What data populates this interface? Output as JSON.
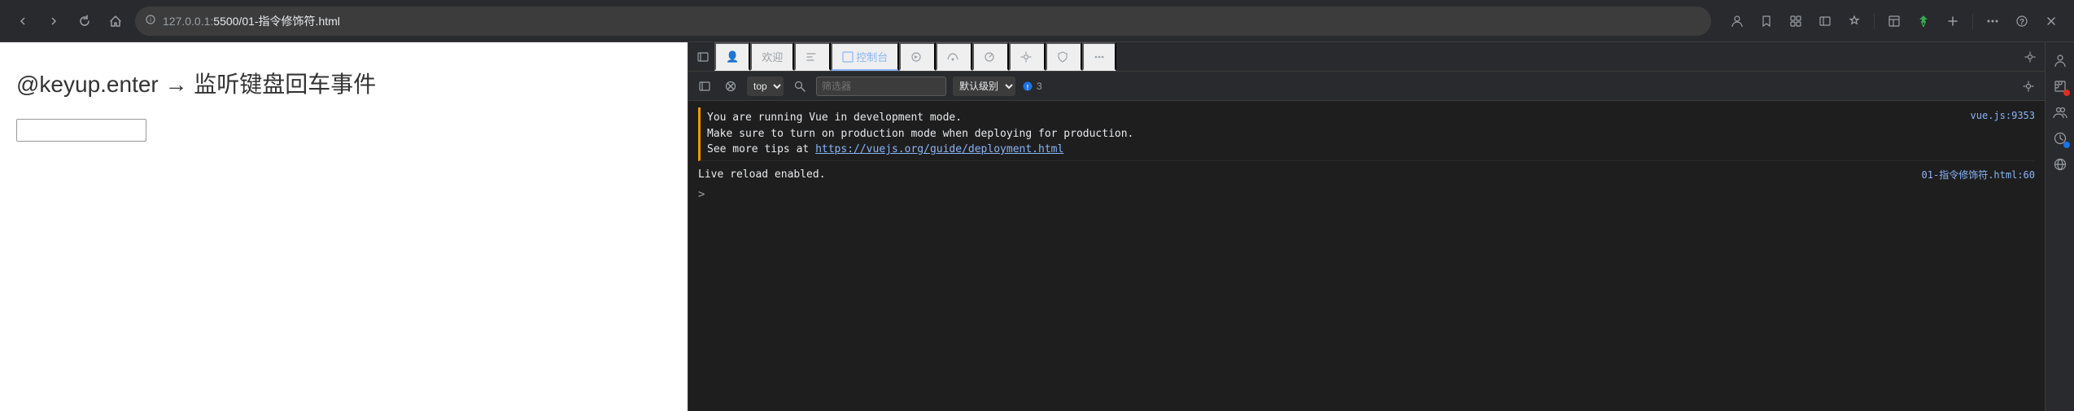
{
  "browser": {
    "url": {
      "protocol": "127.0.0.1:",
      "port_path": "5500/01-指令修饰符.html"
    },
    "nav_buttons": {
      "back": "←",
      "forward": "→",
      "home": "⌂",
      "reload": "↺"
    },
    "toolbar": {
      "profile": "👤",
      "bookmark": "☆",
      "extensions": "🔧",
      "sidebar": "▤",
      "favorites": "✩",
      "collections": "⊞",
      "more": "⋯",
      "help": "?",
      "close": "✕",
      "settings": "⋯",
      "green_btn": "V",
      "plus": "+"
    }
  },
  "webpage": {
    "title": "@keyup.enter → 监听键盘回车事件",
    "input_placeholder": ""
  },
  "devtools": {
    "tabs": [
      {
        "label": "👤",
        "id": "dock-icon"
      },
      {
        "label": "欢迎",
        "id": "welcome"
      },
      {
        "label": "</>",
        "id": "elements"
      },
      {
        "label": "控制台",
        "id": "console",
        "active": true
      },
      {
        "label": "⚙",
        "id": "sources1"
      },
      {
        "label": "📡",
        "id": "network1"
      },
      {
        "label": "⚙",
        "id": "performance"
      },
      {
        "label": "⚙",
        "id": "settings2"
      },
      {
        "label": "🔒",
        "id": "security"
      },
      {
        "label": "⋯",
        "id": "more"
      }
    ],
    "console_toolbar": {
      "top_label": "top",
      "filter_placeholder": "筛选器",
      "level_label": "默认级别",
      "badge_count": "3",
      "search_icon": "🔍"
    },
    "console_messages": [
      {
        "text": "You are running Vue in development mode.",
        "source": "vue.js:9353",
        "type": "warn"
      },
      {
        "text": "Make sure to turn on production mode when deploying for production.",
        "source": "",
        "type": "warn"
      },
      {
        "text": "See more tips at ",
        "link_text": "https://vuejs.org/guide/deployment.html",
        "link_url": "https://vuejs.org/guide/deployment.html",
        "source": "",
        "type": "warn"
      },
      {
        "text": "Live reload enabled.",
        "source": "01-指令修饰符.html:60",
        "type": "info"
      }
    ],
    "prompt": ">"
  },
  "side_icons": [
    {
      "name": "person-icon",
      "symbol": "👤"
    },
    {
      "name": "puzzle-icon",
      "symbol": "🧩",
      "dot": "red"
    },
    {
      "name": "person2-icon",
      "symbol": "👥"
    },
    {
      "name": "clock-icon",
      "symbol": "🕐",
      "dot": "blue"
    },
    {
      "name": "globe-icon",
      "symbol": "🌐"
    }
  ]
}
